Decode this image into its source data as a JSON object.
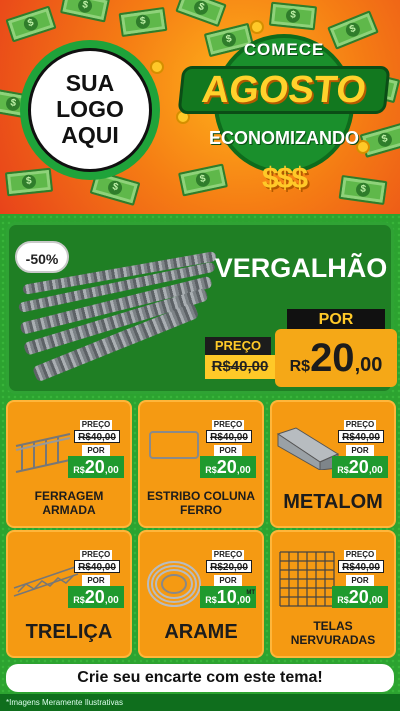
{
  "hero": {
    "logo_lines": [
      "SUA",
      "LOGO",
      "AQUI"
    ],
    "headline_top": "COMECE",
    "headline_main": "AGOSTO",
    "headline_bottom": "ECONOMIZANDO",
    "money_symbols": "$$$"
  },
  "featured": {
    "discount": "-50%",
    "title": "VERGALHÃO",
    "old_price_label": "PREÇO",
    "old_price": "R$40,00",
    "new_price_label": "POR",
    "currency": "R$",
    "price_int": "20",
    "price_cents": ",00"
  },
  "products": [
    {
      "name": "FERRAGEM ARMADA",
      "old_label": "PREÇO",
      "old_price": "R$40,00",
      "new_label": "POR",
      "currency": "R$",
      "price_int": "20",
      "price_cents": ",00"
    },
    {
      "name": "ESTRIBO COLUNA FERRO",
      "old_label": "PREÇO",
      "old_price": "R$40,00",
      "new_label": "POR",
      "currency": "R$",
      "price_int": "20",
      "price_cents": ",00"
    },
    {
      "name": "METALOM",
      "old_label": "PREÇO",
      "old_price": "R$40,00",
      "new_label": "POR",
      "currency": "R$",
      "price_int": "20",
      "price_cents": ",00"
    },
    {
      "name": "TRELIÇA",
      "old_label": "PREÇO",
      "old_price": "R$40,00",
      "new_label": "POR",
      "currency": "R$",
      "price_int": "20",
      "price_cents": ",00"
    },
    {
      "name": "ARAME",
      "old_label": "PREÇO",
      "old_price": "R$20,00",
      "new_label": "POR",
      "currency": "R$",
      "price_int": "10",
      "price_cents": ",00",
      "unit": "MT"
    },
    {
      "name": "TELAS NERVURADAS",
      "old_label": "PREÇO",
      "old_price": "R$40,00",
      "new_label": "POR",
      "currency": "R$",
      "price_int": "20",
      "price_cents": ",00"
    }
  ],
  "cta": "Crie seu encarte com este tema!",
  "disclaimer": "*Imagens Meramente Ilustrativas",
  "colors": {
    "orange": "#f59a12",
    "green": "#1f7f24",
    "yellow": "#ffc928"
  }
}
